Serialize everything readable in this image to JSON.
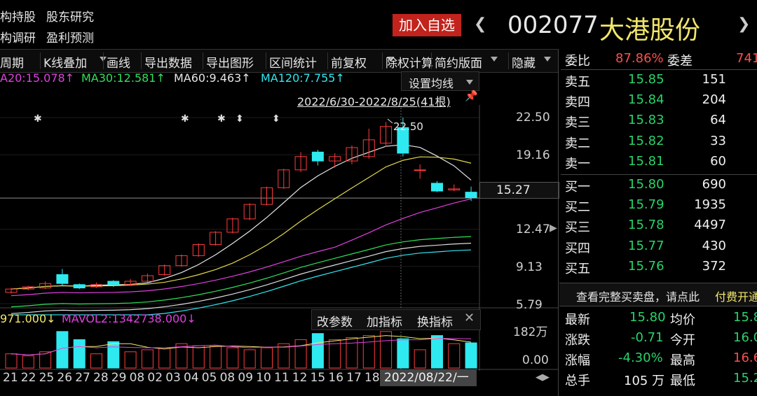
{
  "topnav": {
    "item1": "构持股",
    "item2": "股东研究",
    "item3": "构调研",
    "item4": "盈利预测"
  },
  "header": {
    "add_watch": "加入自选",
    "code": "002077",
    "name": "大港股份"
  },
  "toolbar": {
    "items": [
      "周期",
      "K线叠加",
      "画线",
      "导出数据",
      "导出图形",
      "区间统计",
      "前复权",
      "除权计算",
      "简约版面",
      "隐藏"
    ]
  },
  "ma": {
    "ma20": "A20:15.078↑",
    "ma30": "MA30:12.581↑",
    "ma60": "MA60:9.463↑",
    "ma120": "MA120:7.755↑"
  },
  "chart": {
    "set_ma": "设置均线",
    "range": "2022/6/30-2022/8/25(41根)",
    "peak_label": "22.50",
    "current_price": "15.27",
    "price_ticks": [
      "22.50",
      "19.16",
      "15.27",
      "12.47",
      "9.13",
      "5.79"
    ],
    "vol_ticks": [
      "182万",
      "0.00"
    ]
  },
  "vol": {
    "mavol1": "971.000↓",
    "mavol2": "MAVOL2:1342738.000↓",
    "btn_params": "改参数",
    "btn_add": "加指标",
    "btn_switch": "换指标"
  },
  "dates": {
    "labels": [
      "21",
      "22",
      "25",
      "26",
      "27",
      "28",
      "29",
      "08",
      "02",
      "03",
      "04",
      "05",
      "08",
      "09",
      "10",
      "11",
      "12",
      "15",
      "16",
      "17",
      "18"
    ],
    "cursor": "2022/08/22/一"
  },
  "orderbook": {
    "weibi_label": "委比",
    "weibi_val": "87.86%",
    "weicha_label": "委差",
    "weicha_val": "741",
    "asks": [
      {
        "label": "卖五",
        "price": "15.85",
        "vol": "151"
      },
      {
        "label": "卖四",
        "price": "15.84",
        "vol": "204"
      },
      {
        "label": "卖三",
        "price": "15.83",
        "vol": "64"
      },
      {
        "label": "卖二",
        "price": "15.82",
        "vol": "33"
      },
      {
        "label": "卖一",
        "price": "15.81",
        "vol": "60"
      }
    ],
    "bids": [
      {
        "label": "买一",
        "price": "15.80",
        "vol": "690"
      },
      {
        "label": "买二",
        "price": "15.79",
        "vol": "1935"
      },
      {
        "label": "买三",
        "price": "15.78",
        "vol": "4497"
      },
      {
        "label": "买四",
        "price": "15.77",
        "vol": "430"
      },
      {
        "label": "买五",
        "price": "15.76",
        "vol": "372"
      }
    ],
    "full_book": "查看完整买卖盘，请点此",
    "paid": "付费开通"
  },
  "stats": {
    "latest_label": "最新",
    "latest_val": "15.80",
    "avg_label": "均价",
    "avg_val": "15.8",
    "change_label": "涨跌",
    "change_val": "-0.71",
    "open_label": "今开",
    "open_val": "16.0",
    "pct_label": "涨幅",
    "pct_val": "-4.30%",
    "high_label": "最高",
    "high_val": "16.6",
    "hands_label": "总手",
    "hands_val": "105 万",
    "low_label": "最低",
    "low_val": "15.2"
  },
  "candles": [
    {
      "o": 6.8,
      "c": 7.1,
      "h": 7.2,
      "l": 6.7,
      "v": 0.35
    },
    {
      "o": 7.1,
      "c": 7.3,
      "h": 7.4,
      "l": 7.0,
      "v": 0.3
    },
    {
      "o": 7.2,
      "c": 7.6,
      "h": 7.8,
      "l": 7.1,
      "v": 0.4
    },
    {
      "o": 8.4,
      "c": 7.6,
      "h": 8.9,
      "l": 7.4,
      "v": 0.9
    },
    {
      "o": 7.5,
      "c": 7.2,
      "h": 7.6,
      "l": 7.1,
      "v": 0.7
    },
    {
      "o": 7.3,
      "c": 7.5,
      "h": 7.7,
      "l": 7.2,
      "v": 0.35
    },
    {
      "o": 7.8,
      "c": 7.5,
      "h": 7.9,
      "l": 7.3,
      "v": 0.65
    },
    {
      "o": 7.5,
      "c": 7.8,
      "h": 8.0,
      "l": 7.4,
      "v": 0.4
    },
    {
      "o": 7.8,
      "c": 8.3,
      "h": 8.5,
      "l": 7.7,
      "v": 0.45
    },
    {
      "o": 8.4,
      "c": 9.2,
      "h": 9.3,
      "l": 8.3,
      "v": 0.5
    },
    {
      "o": 9.2,
      "c": 10.1,
      "h": 10.2,
      "l": 9.1,
      "v": 0.6
    },
    {
      "o": 10.1,
      "c": 11.1,
      "h": 11.2,
      "l": 10.0,
      "v": 0.55
    },
    {
      "o": 11.1,
      "c": 12.2,
      "h": 12.3,
      "l": 11.0,
      "v": 0.55
    },
    {
      "o": 12.2,
      "c": 13.4,
      "h": 13.5,
      "l": 12.1,
      "v": 0.5
    },
    {
      "o": 13.4,
      "c": 14.7,
      "h": 14.8,
      "l": 13.3,
      "v": 0.45
    },
    {
      "o": 14.7,
      "c": 16.2,
      "h": 16.3,
      "l": 14.6,
      "v": 0.5
    },
    {
      "o": 16.2,
      "c": 17.8,
      "h": 17.9,
      "l": 16.1,
      "v": 0.6
    },
    {
      "o": 17.8,
      "c": 19.0,
      "h": 19.4,
      "l": 17.6,
      "v": 0.7
    },
    {
      "o": 19.4,
      "c": 18.6,
      "h": 19.6,
      "l": 18.2,
      "v": 0.85
    },
    {
      "o": 18.6,
      "c": 19.0,
      "h": 19.3,
      "l": 18.0,
      "v": 0.7
    },
    {
      "o": 18.6,
      "c": 19.8,
      "h": 20.0,
      "l": 18.3,
      "v": 0.75
    },
    {
      "o": 19.0,
      "c": 20.5,
      "h": 21.5,
      "l": 18.8,
      "v": 0.8
    },
    {
      "o": 20.2,
      "c": 21.7,
      "h": 22.1,
      "l": 19.9,
      "v": 0.9
    },
    {
      "o": 21.6,
      "c": 19.3,
      "h": 22.5,
      "l": 19.0,
      "v": 0.72
    },
    {
      "o": 17.8,
      "c": 17.8,
      "h": 18.3,
      "l": 17.0,
      "v": 0.45
    },
    {
      "o": 16.6,
      "c": 15.9,
      "h": 16.8,
      "l": 15.8,
      "v": 0.8
    },
    {
      "o": 16.0,
      "c": 16.1,
      "h": 16.5,
      "l": 15.9,
      "v": 0.6
    },
    {
      "o": 15.8,
      "c": 15.3,
      "h": 16.3,
      "l": 15.0,
      "v": 0.62
    }
  ]
}
